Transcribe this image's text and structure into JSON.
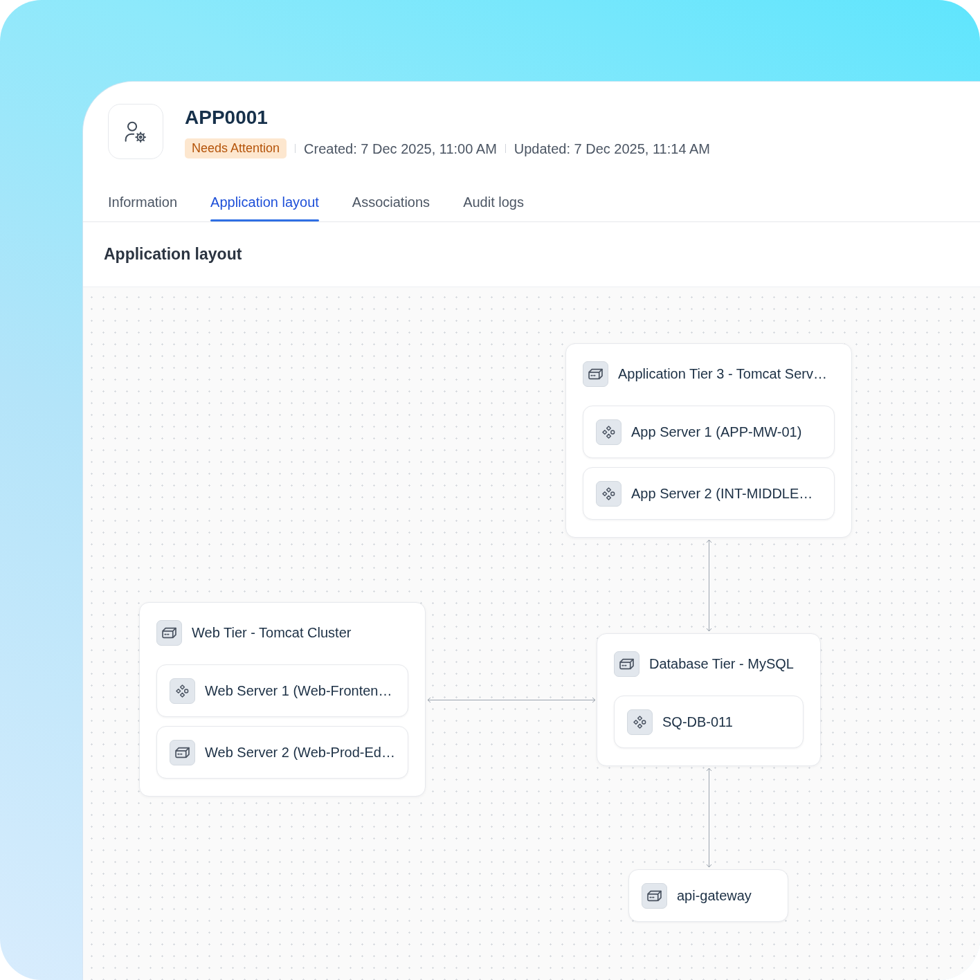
{
  "header": {
    "title": "APP0001",
    "status": "Needs Attention",
    "meta": [
      "Created: 7 Dec 2025, 11:00 AM",
      "Updated: 7 Dec 2025, 11:14 AM"
    ]
  },
  "tabs": [
    {
      "label": "Information",
      "selected": false
    },
    {
      "label": "Application layout",
      "selected": true
    },
    {
      "label": "Associations",
      "selected": false
    },
    {
      "label": "Audit logs",
      "selected": false
    }
  ],
  "section": {
    "title": "Application layout"
  },
  "diagram": {
    "nodes": [
      {
        "kind": "server",
        "label": "Application Tier 3 - Tomcat Serv…",
        "children": [
          {
            "kind": "component",
            "label": "App Server 1 (APP-MW-01)"
          },
          {
            "kind": "component",
            "label": "App Server 2 (INT-MIDDLE…"
          }
        ]
      },
      {
        "kind": "server",
        "label": "Web Tier - Tomcat Cluster",
        "children": [
          {
            "kind": "component",
            "label": "Web Server 1 (Web-Fronten…"
          },
          {
            "kind": "server",
            "label": "Web Server 2 (Web-Prod-Ed…"
          }
        ]
      },
      {
        "kind": "server",
        "label": "Database Tier - MySQL",
        "children": [
          {
            "kind": "component",
            "label": "SQ-DB-011"
          }
        ]
      },
      {
        "kind": "server",
        "label": "api-gateway"
      }
    ]
  }
}
